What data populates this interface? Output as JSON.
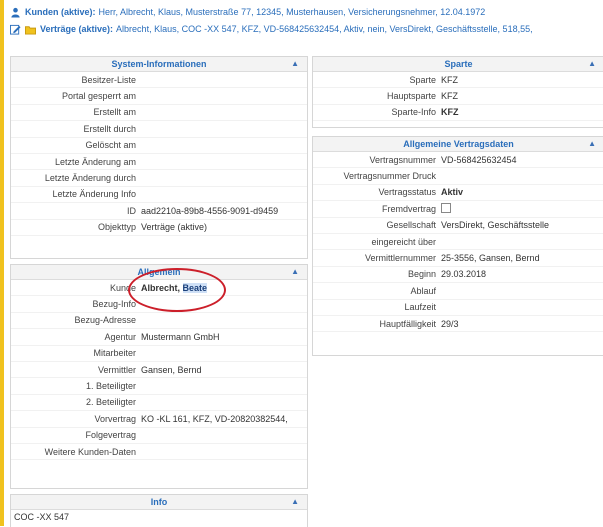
{
  "colors": {
    "accent": "#f0c21e",
    "link": "#2a6ebb",
    "annotation": "#cc1f2a"
  },
  "header": {
    "line1": {
      "icon": "person-icon",
      "label": "Kunden (aktive):",
      "text": "Herr, Albrecht, Klaus, Musterstraße 77, 12345, Musterhausen, Versicherungsnehmer, 12.04.1972"
    },
    "line2": {
      "icons": [
        "edit-icon",
        "folder-icon"
      ],
      "label": "Verträge (aktive):",
      "text": "Albrecht, Klaus, COC -XX 547, KFZ, VD-568425632454, Aktiv, nein, VersDirekt, Geschäftsstelle, 518,55,"
    }
  },
  "system": {
    "title": "System-Informationen",
    "rows": [
      {
        "label": "Besitzer-Liste",
        "value": ""
      },
      {
        "label": "Portal gesperrt am",
        "value": ""
      },
      {
        "label": "Erstellt am",
        "value": ""
      },
      {
        "label": "Erstellt durch",
        "value": ""
      },
      {
        "label": "Gelöscht am",
        "value": ""
      },
      {
        "label": "Letzte Änderung am",
        "value": ""
      },
      {
        "label": "Letzte Änderung durch",
        "value": ""
      },
      {
        "label": "Letzte Änderung Info",
        "value": ""
      },
      {
        "label": "ID",
        "value": "aad2210a-89b8-4556-9091-d9459"
      },
      {
        "label": "Objekttyp",
        "value": "Verträge (aktive)"
      }
    ]
  },
  "allgemein": {
    "title": "Allgemein",
    "kunde_label": "Kunde",
    "kunde_name1": "Albrecht,",
    "kunde_name2": "Beate",
    "rows": [
      {
        "label": "Bezug-Info",
        "value": ""
      },
      {
        "label": "Bezug-Adresse",
        "value": ""
      },
      {
        "label": "Agentur",
        "value": "Mustermann GmbH"
      },
      {
        "label": "Mitarbeiter",
        "value": ""
      },
      {
        "label": "Vermittler",
        "value": "Gansen, Bernd"
      },
      {
        "label": "1. Beteiligter",
        "value": ""
      },
      {
        "label": "2. Beteiligter",
        "value": ""
      },
      {
        "label": "Vorvertrag",
        "value": "KO -KL 161, KFZ, VD-20820382544,"
      },
      {
        "label": "Folgevertrag",
        "value": ""
      },
      {
        "label": "Weitere Kunden-Daten",
        "value": ""
      }
    ]
  },
  "info": {
    "title": "Info",
    "text": "COC -XX 547"
  },
  "sparte": {
    "title": "Sparte",
    "rows": [
      {
        "label": "Sparte",
        "value": "KFZ",
        "bold": false
      },
      {
        "label": "Hauptsparte",
        "value": "KFZ",
        "bold": false
      },
      {
        "label": "Sparte-Info",
        "value": "KFZ",
        "bold": true
      }
    ]
  },
  "vertrag": {
    "title": "Allgemeine Vertragsdaten",
    "rows": [
      {
        "label": "Vertragsnummer",
        "value": "VD-568425632454"
      },
      {
        "label": "Vertragsnummer Druck",
        "value": ""
      },
      {
        "label": "Vertragsstatus",
        "value": "Aktiv"
      },
      {
        "label": "Fremdvertrag",
        "value": ""
      },
      {
        "label": "Gesellschaft",
        "value": "VersDirekt, Geschäftsstelle"
      },
      {
        "label": "eingereicht über",
        "value": ""
      },
      {
        "label": "Vermittlernummer",
        "value": "25-3556, Gansen, Bernd"
      },
      {
        "label": "Beginn",
        "value": "29.03.2018"
      },
      {
        "label": "Ablauf",
        "value": ""
      },
      {
        "label": "Laufzeit",
        "value": ""
      },
      {
        "label": "Hauptfälligkeit",
        "value": "29/3"
      }
    ]
  }
}
